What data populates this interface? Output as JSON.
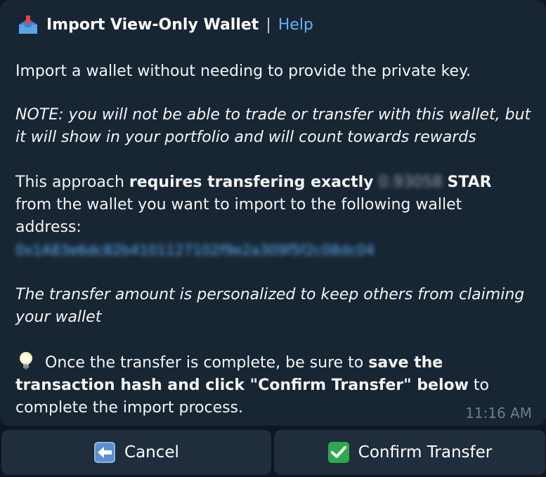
{
  "header": {
    "icon": "inbox-tray-icon",
    "title": "Import View-Only Wallet",
    "separator": "|",
    "help_label": "Help"
  },
  "message": {
    "intro": "Import a wallet without needing to provide the private key.",
    "note": "NOTE: you will not be able to trade or transfer with this wallet, but it will show in your portfolio and will count towards rewards",
    "approach_prefix": "This approach ",
    "approach_bold": "requires transfering exactly",
    "amount": "0.93058",
    "currency": "STAR",
    "approach_suffix": " from the wallet you want to import to the following wallet address:",
    "wallet_address": "0x1A83e6dc82b4101127102f9e2a309f5f2c08dc04",
    "personalized_note": "The transfer amount is personalized to keep others from claiming your wallet",
    "bulb_icon": "light-bulb-icon",
    "final_prefix": "Once the transfer is complete, be sure to ",
    "final_bold": "save the transaction hash and click \"Confirm Transfer\" below",
    "final_suffix": " to complete the import process.",
    "timestamp": "11:16 AM"
  },
  "buttons": {
    "cancel_label": "Cancel",
    "cancel_icon": "left-arrow-icon",
    "confirm_label": "Confirm Transfer",
    "confirm_icon": "check-mark-icon"
  },
  "colors": {
    "background": "#0e1621",
    "bubble": "#182533",
    "button": "#1f2d3c",
    "link": "#5eb5f7",
    "timestamp": "#6d7f8f",
    "check_green": "#2fa84f",
    "arrow_blue": "#5a8fd0"
  }
}
